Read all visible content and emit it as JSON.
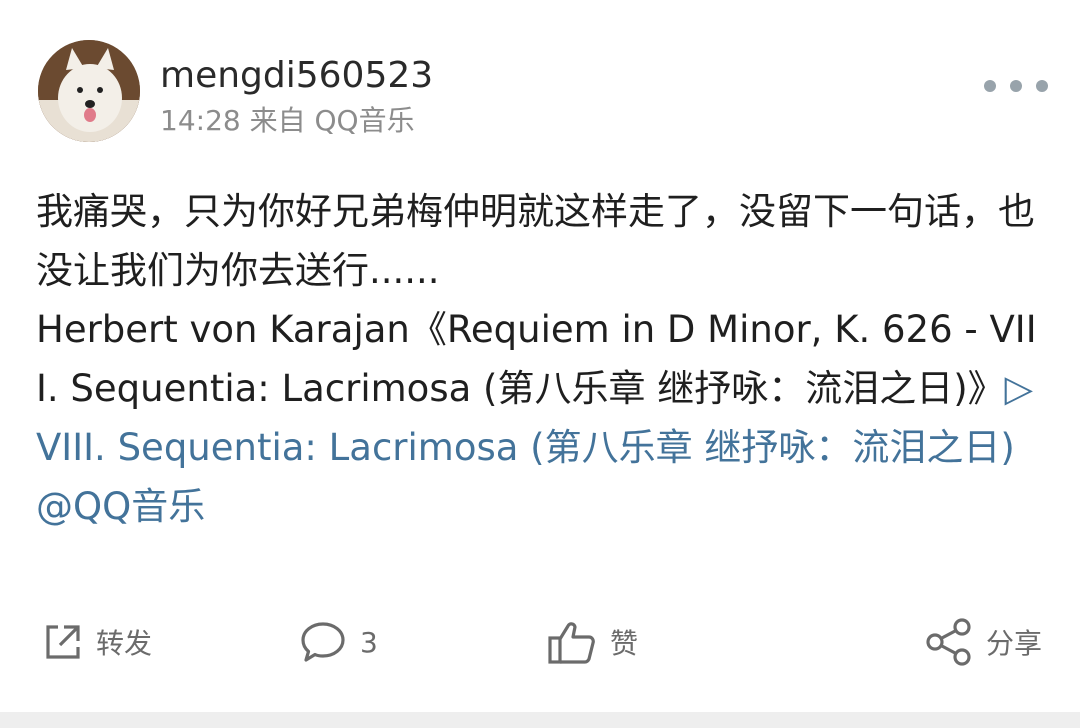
{
  "post": {
    "username": "mengdi560523",
    "time": "14:28",
    "source": "来自 QQ音乐",
    "text_main": "我痛哭，只为你好兄弟梅仲明就这样走了，没留下一句话，也没让我们为你去送行......",
    "text_music": "Herbert von Karajan《Requiem in D Minor, K. 626 - VIII. Sequentia: Lacrimosa (第八乐章 继抒咏：流泪之日)》",
    "link_text": "▷VIII. Sequentia: Lacrimosa (第八乐章 继抒咏：流泪之日)@QQ音乐"
  },
  "actions": {
    "repost_label": "转发",
    "comment_count": "3",
    "like_label": "赞",
    "share_label": "分享"
  },
  "colors": {
    "link": "#43739a",
    "meta": "#8c8c8c",
    "icon": "#6b6b6b"
  }
}
